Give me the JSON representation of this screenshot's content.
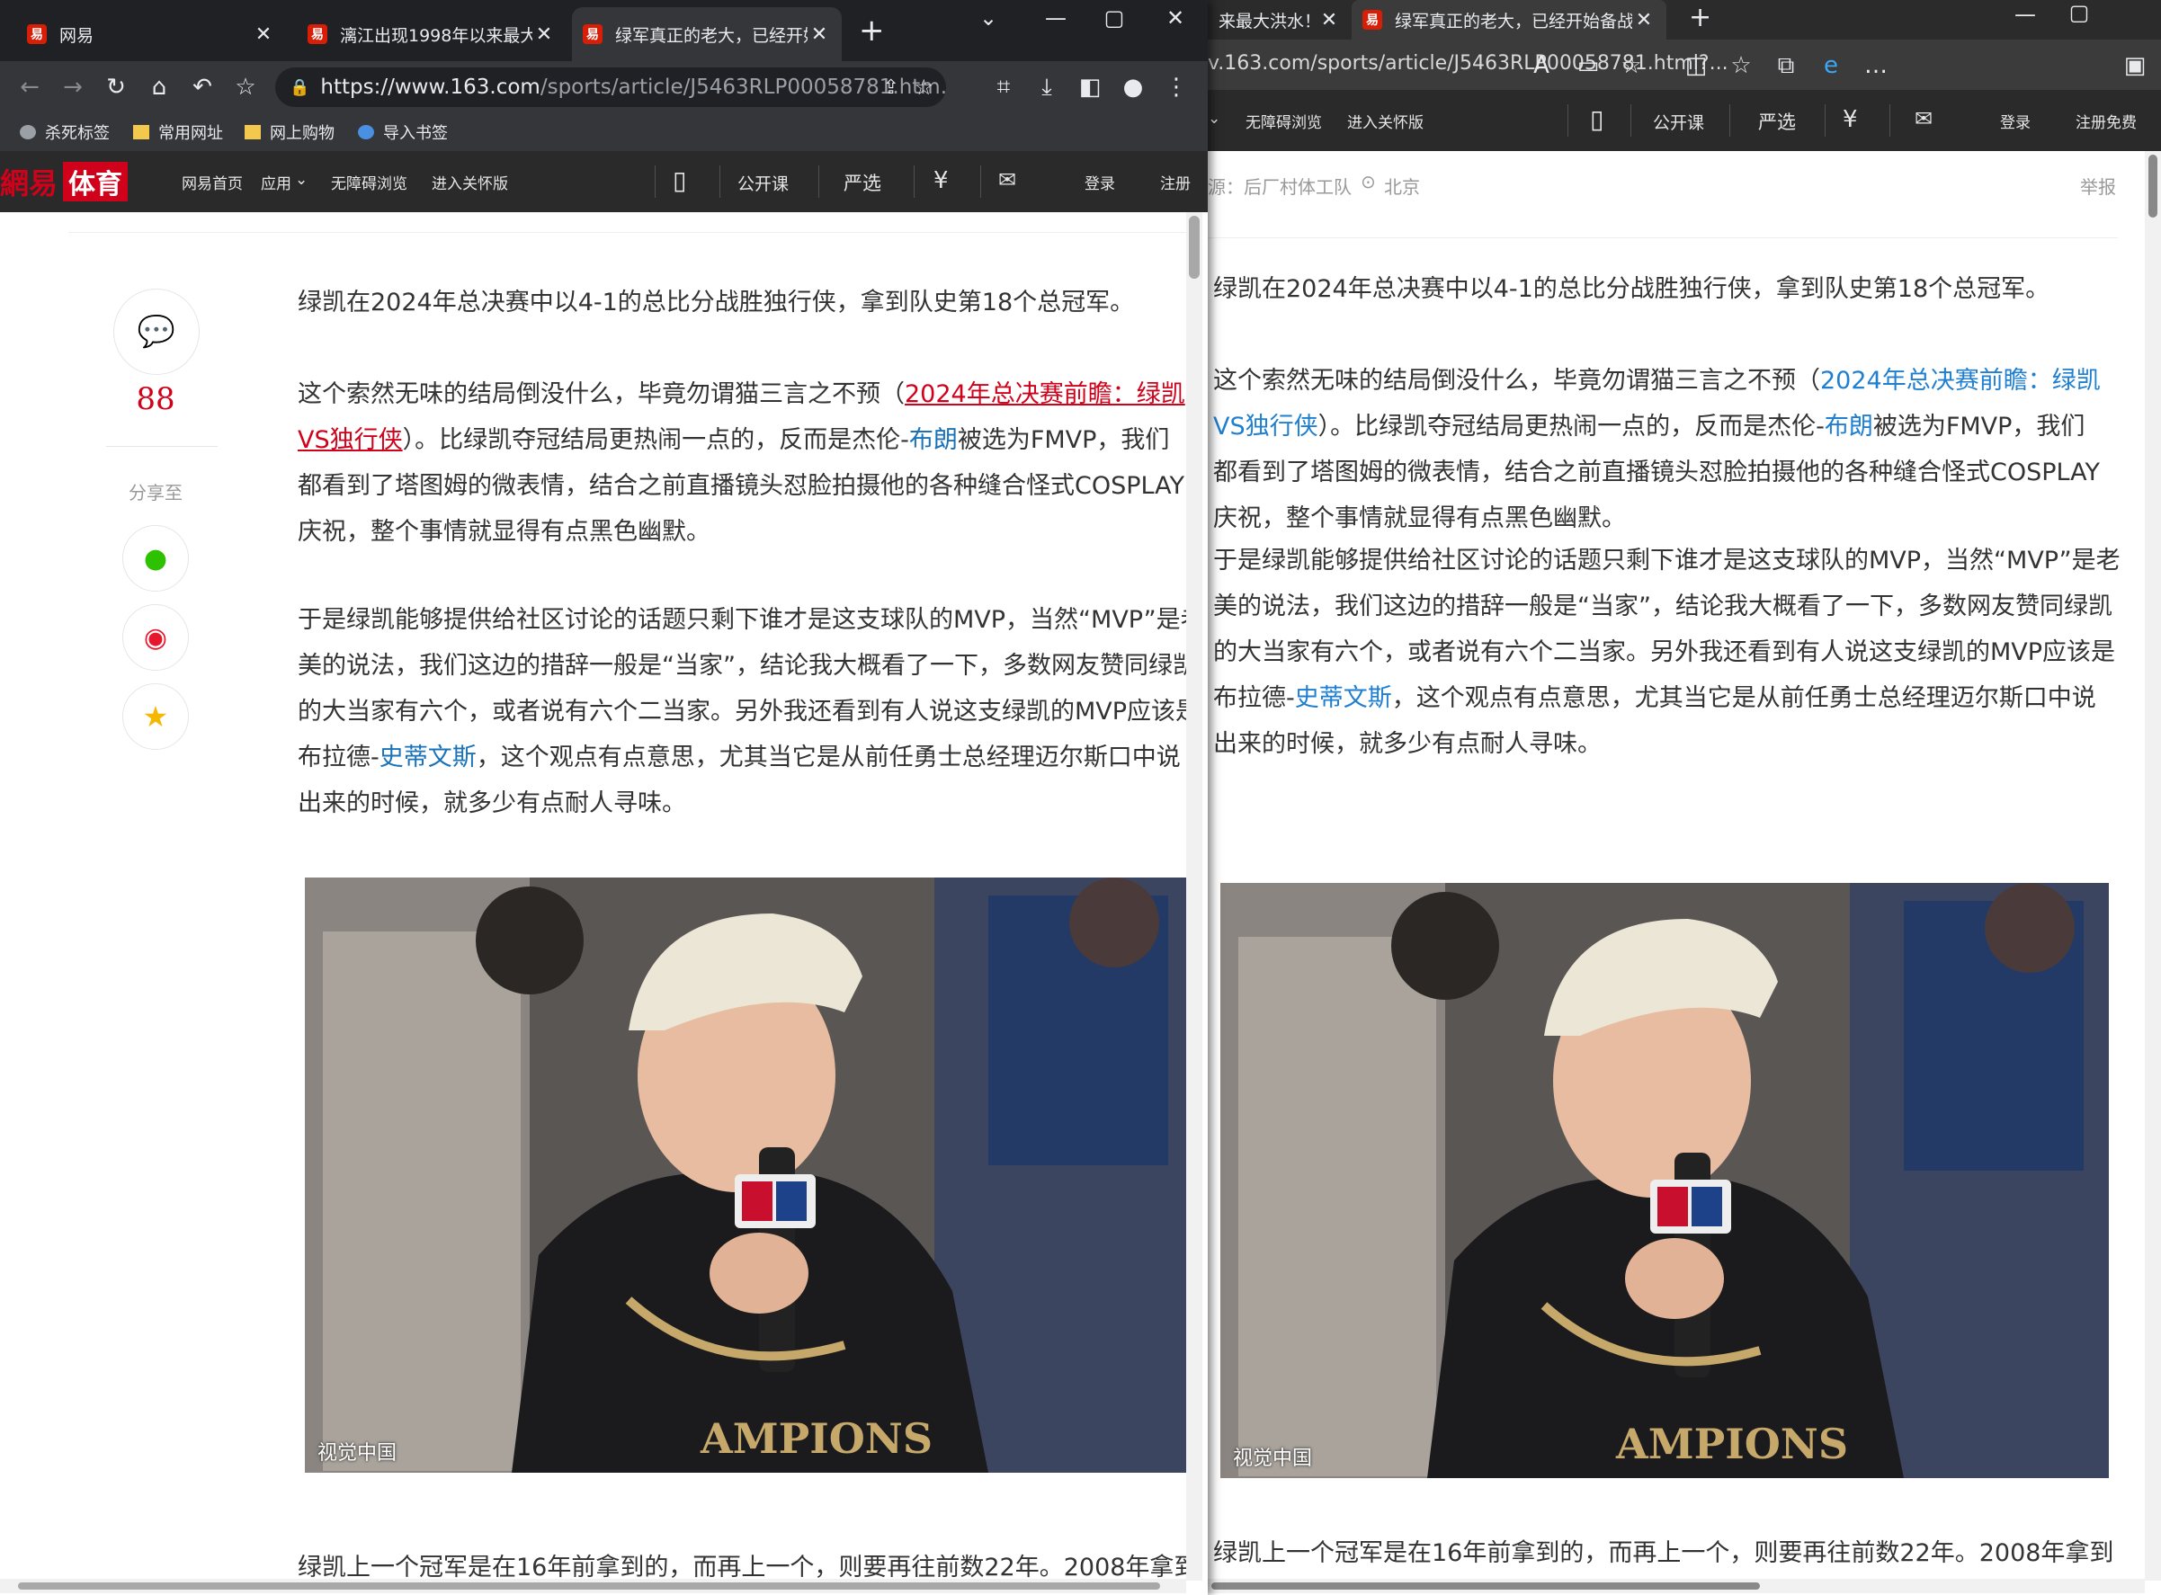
{
  "left": {
    "tabs": [
      {
        "label": "网易"
      },
      {
        "label": "漓江出现1998年以来最大"
      },
      {
        "label": "绿军真正的老大，已经开始"
      }
    ],
    "favicon_glyph": "易",
    "url_host": "https://www.163.com",
    "url_path": "/sports/article/J5463RLP00058781.htm...",
    "bookmarks": [
      "杀死标签",
      "常用网址",
      "网上购物",
      "导入书签"
    ],
    "site_logo_a": "網易",
    "site_logo_b": "体育",
    "nav": [
      "网易首页",
      "应用",
      "无障碍浏览",
      "进入关怀版"
    ],
    "nav_right": [
      "公开课",
      "严选",
      "登录",
      "注册"
    ],
    "comment_count": "88",
    "share_label": "分享至",
    "p1": "绿凯在2024年总决赛中以4-1的总比分战胜独行侠，拿到队史第18个总冠军。",
    "p2_a": "这个索然无味的结局倒没什么，毕竟勿谓猫三言之不预（",
    "p2_link1": "2024年总决赛前瞻：绿凯",
    "p2_link1b": "VS独行侠",
    "p2_b": "）。比绿凯夺冠结局更热闹一点的，反而是杰伦-",
    "p2_link2": "布朗",
    "p2_c": "被选为FMVP，我们",
    "p2_d": "都看到了塔图姆的微表情，结合之前直播镜头怼脸拍摄他的各种缝合怪式COSPLAY",
    "p2_e": "庆祝，整个事情就显得有点黑色幽默。",
    "p3_a": "于是绿凯能够提供给社区讨论的话题只剩下谁才是这支球队的MVP，当然“MVP”是老",
    "p3_b": "美的说法，我们这边的措辞一般是“当家”，结论我大概看了一下，多数网友赞同绿凯",
    "p3_c": "的大当家有六个，或者说有六个二当家。另外我还看到有人说这支绿凯的MVP应该是",
    "p3_d1": "布拉德-",
    "p3_link": "史蒂文斯",
    "p3_d2": "，这个观点有点意思，尤其当它是从前任勇士总经理迈尔斯口中说",
    "p3_e": "出来的时候，就多少有点耐人寻味。",
    "photo_credit": "视觉中国",
    "p4": "绿凯上一个冠军是在16年前拿到的，而再上一个，则要再往前数22年。2008年拿到"
  },
  "right": {
    "tabs": [
      {
        "label": "来最大洪水！"
      },
      {
        "label": "绿军真正的老大，已经开始备战"
      }
    ],
    "url": "v.163.com/sports/article/J5463RLP00058781.html?...",
    "nav": [
      "无障碍浏览",
      "进入关怀版"
    ],
    "nav_right": [
      "公开课",
      "严选",
      "登录",
      "注册免费"
    ],
    "source": "源：后厂村体工队",
    "location": "北京",
    "report": "举报"
  },
  "colors": {
    "accent_red": "#d0021b",
    "link_blue": "#1a73b8"
  }
}
